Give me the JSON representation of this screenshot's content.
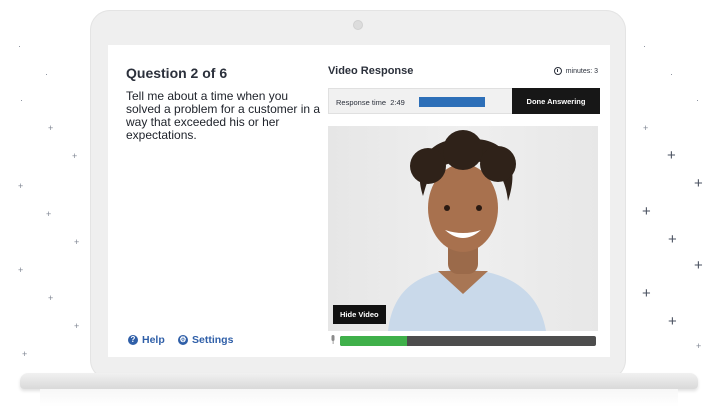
{
  "question": {
    "title": "Question 2 of 6",
    "text": "Tell me about a time when you solved a problem for a customer in a way that exceeded his or her expectations."
  },
  "video_panel": {
    "title": "Video Response",
    "timer_label": "minutes: 3",
    "response_time_label": "Response time",
    "response_time_value": "2:49",
    "done_button": "Done Answering",
    "hide_video_button": "Hide Video",
    "audio_level": 0.26
  },
  "footer": {
    "help": "Help",
    "settings": "Settings"
  },
  "colors": {
    "accent_blue": "#2f5fa8",
    "progress_blue": "#2d6fb8",
    "audio_green": "#3fb04a",
    "button_dark": "#171717"
  },
  "icons": [
    "help-icon",
    "settings-icon",
    "clock-icon",
    "microphone-icon",
    "webcam-icon"
  ]
}
